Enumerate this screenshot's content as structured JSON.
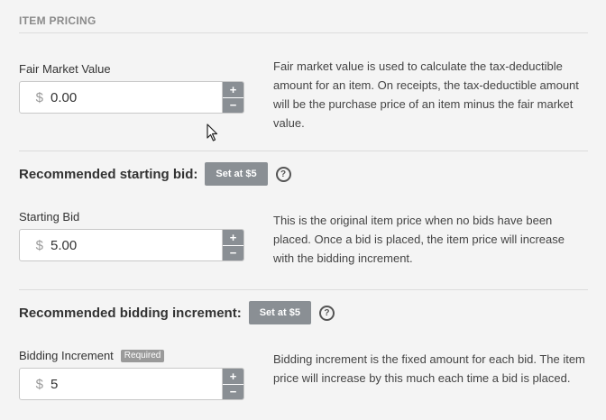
{
  "section": {
    "title": "ITEM PRICING"
  },
  "fair_market": {
    "label": "Fair Market Value",
    "currency": "$",
    "value": "0.00",
    "help": "Fair market value is used to calculate the tax-deductible amount for an item. On receipts, the tax-deductible amount will be the purchase price of an item minus the fair market value."
  },
  "rec_start": {
    "label": "Recommended starting bid:",
    "button": "Set at $5",
    "help_glyph": "?"
  },
  "starting_bid": {
    "label": "Starting Bid",
    "currency": "$",
    "value": "5.00",
    "help": "This is the original item price when no bids have been placed. Once a bid is placed, the item price will increase with the bidding increment."
  },
  "rec_increment": {
    "label": "Recommended bidding increment:",
    "button": "Set at $5",
    "help_glyph": "?"
  },
  "bidding_increment": {
    "label": "Bidding Increment",
    "badge": "Required",
    "currency": "$",
    "value": "5",
    "help": "Bidding increment is the fixed amount for each bid. The item price will increase by this much each time a bid is placed."
  },
  "stepper": {
    "up": "+",
    "down": "−"
  },
  "colors": {
    "background": "#f4f4f4",
    "button": "#8a8f94",
    "divider": "#dcdcdc"
  }
}
